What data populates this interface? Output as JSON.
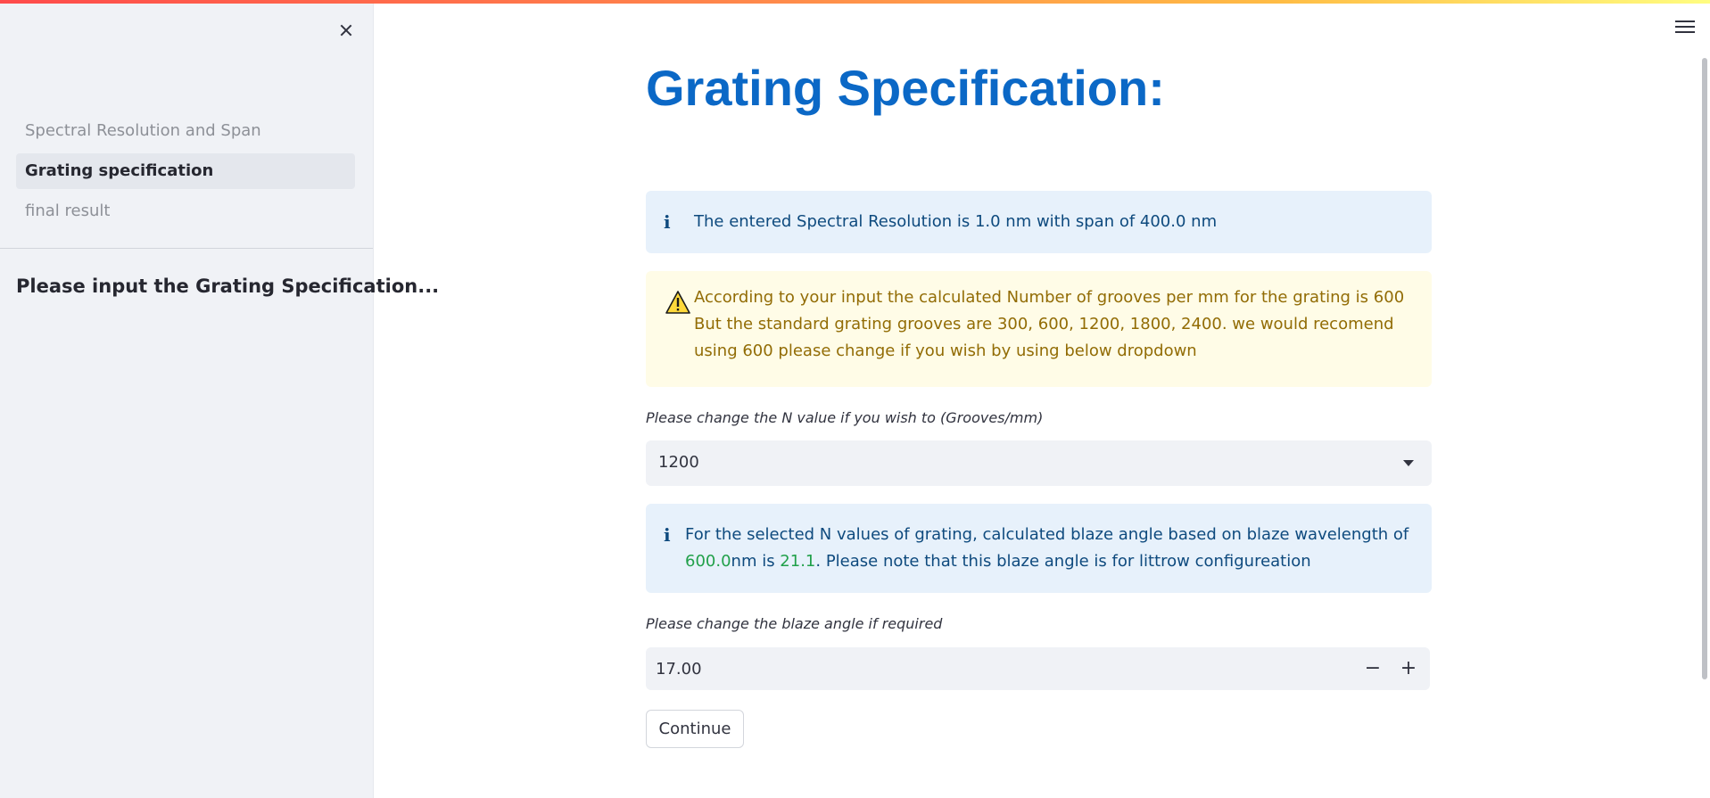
{
  "sidebar": {
    "items": [
      {
        "label": "Spectral Resolution and Span"
      },
      {
        "label": "Grating specification"
      },
      {
        "label": "final result"
      }
    ],
    "heading": "Please input the Grating Specification..."
  },
  "main": {
    "title": "Grating Specification:",
    "info1": "The entered Spectral Resolution is 1.0 nm with span of 400.0 nm",
    "warning": "According to your input the calculated Number of grooves per mm for the grating is 600 But the standard grating grooves are 300, 600, 1200, 1800, 2400. we would recomend using 600 please change if you wish by using below dropdown",
    "n_label": "Please change the N value if you wish to (Grooves/mm)",
    "n_selected": "1200",
    "info2": {
      "part1": "For the selected N values of grating, calculated blaze angle based on blaze wavelength of ",
      "wavelength": "600.0",
      "part2": "nm is ",
      "angle": "21.1",
      "part3": ". Please note that this blaze angle is for littrow configureation"
    },
    "blaze_label": "Please change the blaze angle if required",
    "blaze_value": "17.00",
    "minus_label": "−",
    "plus_label": "+",
    "continue_label": "Continue"
  },
  "colors": {
    "title": "#0b68c6",
    "info_bg": "#e7f1fb",
    "warning_bg": "#fffce7",
    "highlight": "#21a04a"
  },
  "icons": {
    "close": "close-icon",
    "menu": "hamburger-menu-icon",
    "info": "info-icon",
    "warning": "warning-icon",
    "dropdown": "chevron-down-icon"
  }
}
